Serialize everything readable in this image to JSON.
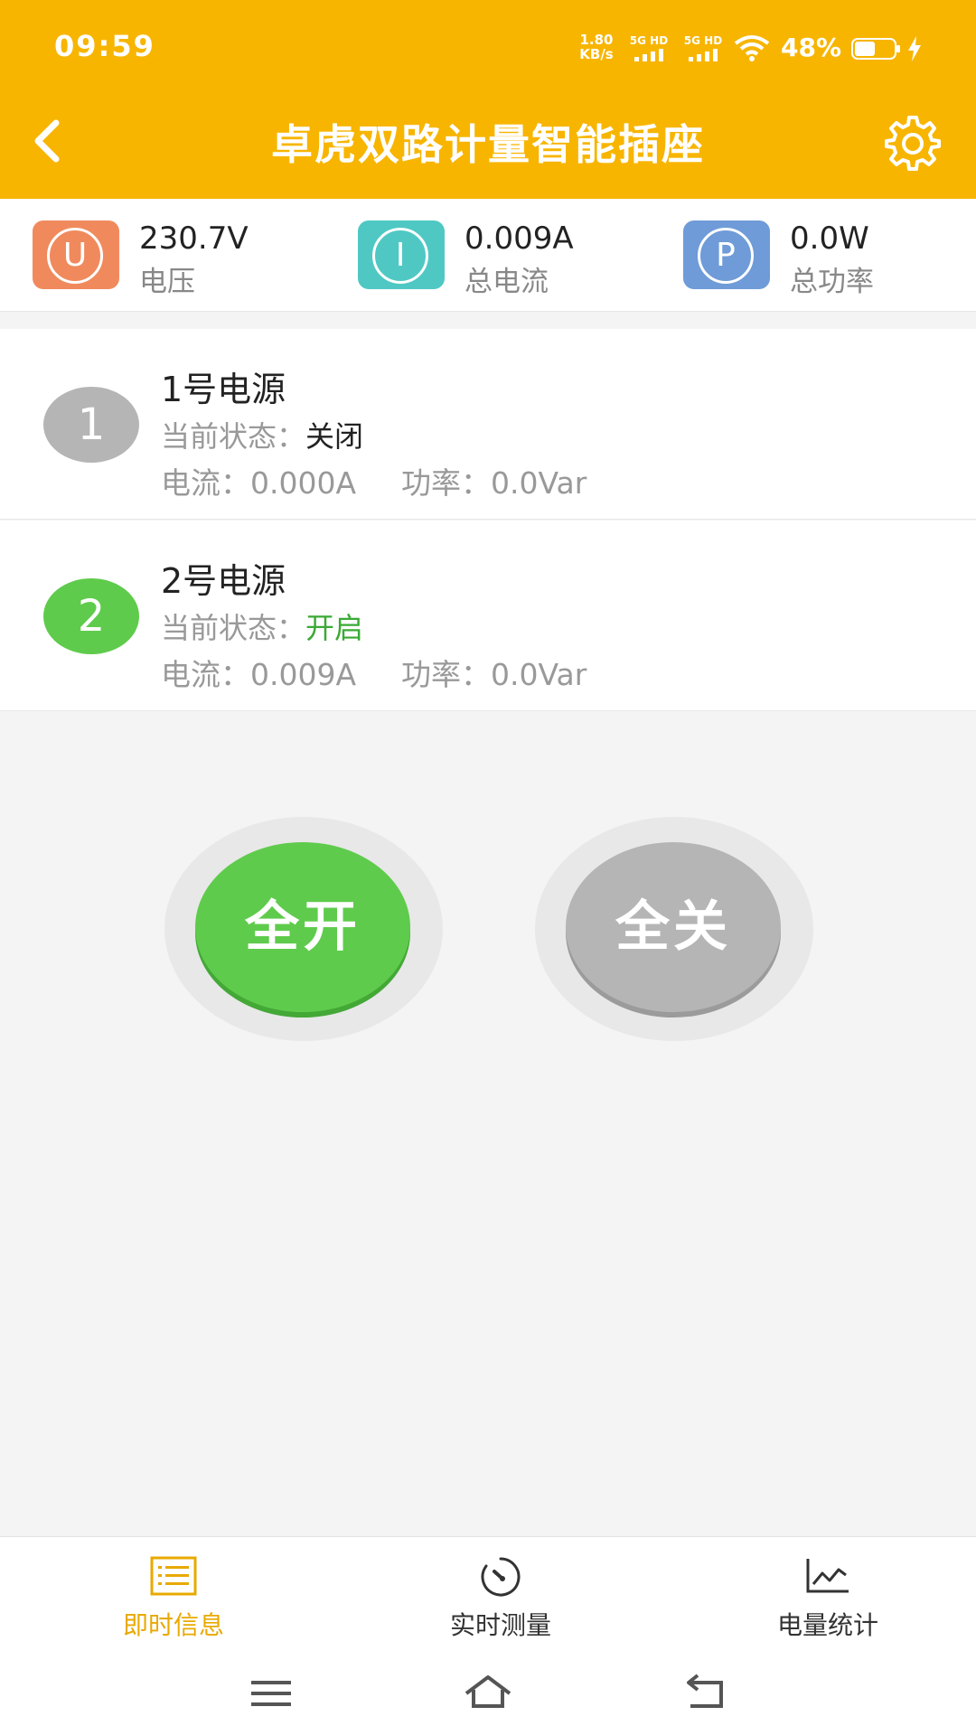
{
  "status_bar": {
    "time": "09:59",
    "net_speed_value": "1.80",
    "net_speed_unit": "KB/s",
    "signal_labels": [
      "5G HD",
      "5G HD"
    ],
    "battery": "48%"
  },
  "header": {
    "title": "卓虎双路计量智能插座",
    "back_icon": "chevron-left-icon",
    "settings_icon": "gear-icon"
  },
  "metrics": [
    {
      "symbol": "U",
      "value": "230.7V",
      "label": "电压",
      "color": "#f08a5d"
    },
    {
      "symbol": "I",
      "value": "0.009A",
      "label": "总电流",
      "color": "#4fc8c4"
    },
    {
      "symbol": "P",
      "value": "0.0W",
      "label": "总功率",
      "color": "#6f9bd8"
    }
  ],
  "channels": [
    {
      "index": "1",
      "name": "1号电源",
      "state_label": "当前状态：",
      "state": "关闭",
      "current_label": "电流：",
      "current": "0.000A",
      "power_label": "功率：",
      "power": "0.0Var",
      "badge_color": "#b5b5b5"
    },
    {
      "index": "2",
      "name": "2号电源",
      "state_label": "当前状态：",
      "state": "开启",
      "current_label": "电流：",
      "current": "0.009A",
      "power_label": "功率：",
      "power": "0.0Var",
      "badge_color": "#5fcb4c"
    }
  ],
  "actions": {
    "all_on": "全开",
    "all_off": "全关"
  },
  "bottom_nav": [
    {
      "label": "即时信息",
      "icon": "list-icon",
      "active": true
    },
    {
      "label": "实时测量",
      "icon": "gauge-icon",
      "active": false
    },
    {
      "label": "电量统计",
      "icon": "line-chart-icon",
      "active": false
    }
  ],
  "colors": {
    "accent": "#f7b500",
    "on_green": "#5fcb4c",
    "off_gray": "#b5b5b5",
    "active_nav": "#e8a900"
  }
}
